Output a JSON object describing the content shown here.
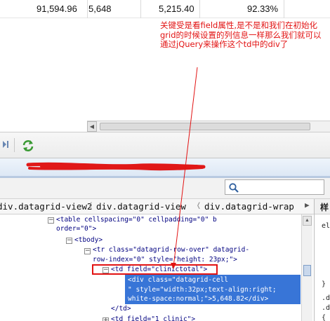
{
  "grid": {
    "top_row": [
      "91,594.96",
      "5,648",
      "5,215.40",
      "92.33%"
    ]
  },
  "pager": {
    "last_icon": "last-page-icon",
    "refresh_icon": "refresh-icon"
  },
  "search": {
    "icon": "search-icon",
    "value": ""
  },
  "breadcrumb": {
    "items": [
      "div.datagrid-view2",
      "div.datagrid-view",
      "div.datagrid-wrap"
    ],
    "scroll_right": "▶"
  },
  "side_panel": {
    "tab": "样",
    "lines": [
      "el",
      "}",
      ".d",
      ".d",
      "{"
    ]
  },
  "tree": {
    "lines": [
      "<table cellspacing=\"0\" cellpadding=\"0\" b",
      "order=\"0\">",
      "<tbody>",
      "<tr class=\"datagrid-row-over\" datagrid-",
      "row-index=\"0\" style=\"height: 23px;\">",
      "<td field=\"clinictotal\">",
      "</td>",
      "<td field=\"1_clinic\">"
    ],
    "selected": [
      "<div class=\"datagrid-cell",
      "\" style=\"width:32px;text-align:right;",
      "white-space:normal;\">5,648.82</div>"
    ]
  },
  "annotation": {
    "text": "关键受是看field属性,是不是和我们在初始化grid的时候设置的列信息一样那么我们就可以通过jQuery来操作这个td中的div了",
    "color": "#e21313"
  },
  "colors": {
    "selection": "#3875d7",
    "highlight_box": "#e21313"
  }
}
